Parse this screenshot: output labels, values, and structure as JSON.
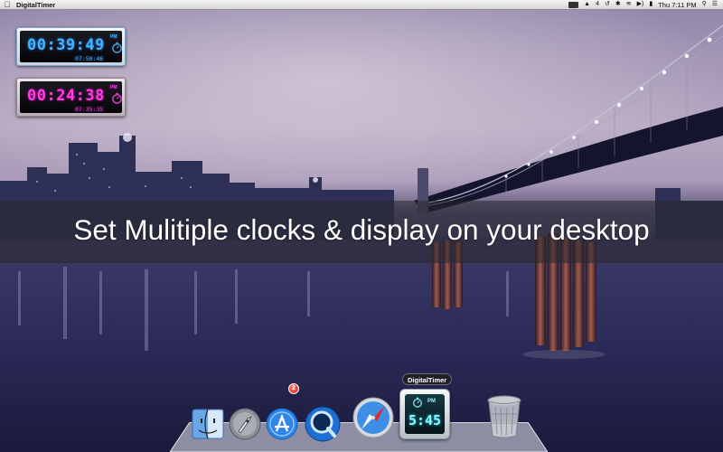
{
  "menubar": {
    "app_name": "DigitalTimer",
    "status_number": "4",
    "clock": "Thu 7:11 PM"
  },
  "widgets": [
    {
      "time": "00:39:49",
      "ampm": "PM",
      "sub": "07:50:46",
      "color": "#46b3ff"
    },
    {
      "time": "00:24:38",
      "ampm": "PM",
      "sub": "07:35:35",
      "color": "#ff3fe0"
    }
  ],
  "caption": "Set Mulitiple clocks & display on your desktop",
  "dock": {
    "tooltip": "DigitalTimer",
    "app_store_badge": "2",
    "digitaltimer_time": "5:45",
    "digitaltimer_ampm": "PM",
    "items": [
      "finder-icon",
      "launchpad-icon",
      "app-store-icon",
      "quicktime-icon",
      "safari-icon",
      "digitaltimer-icon",
      "trash-icon"
    ]
  }
}
